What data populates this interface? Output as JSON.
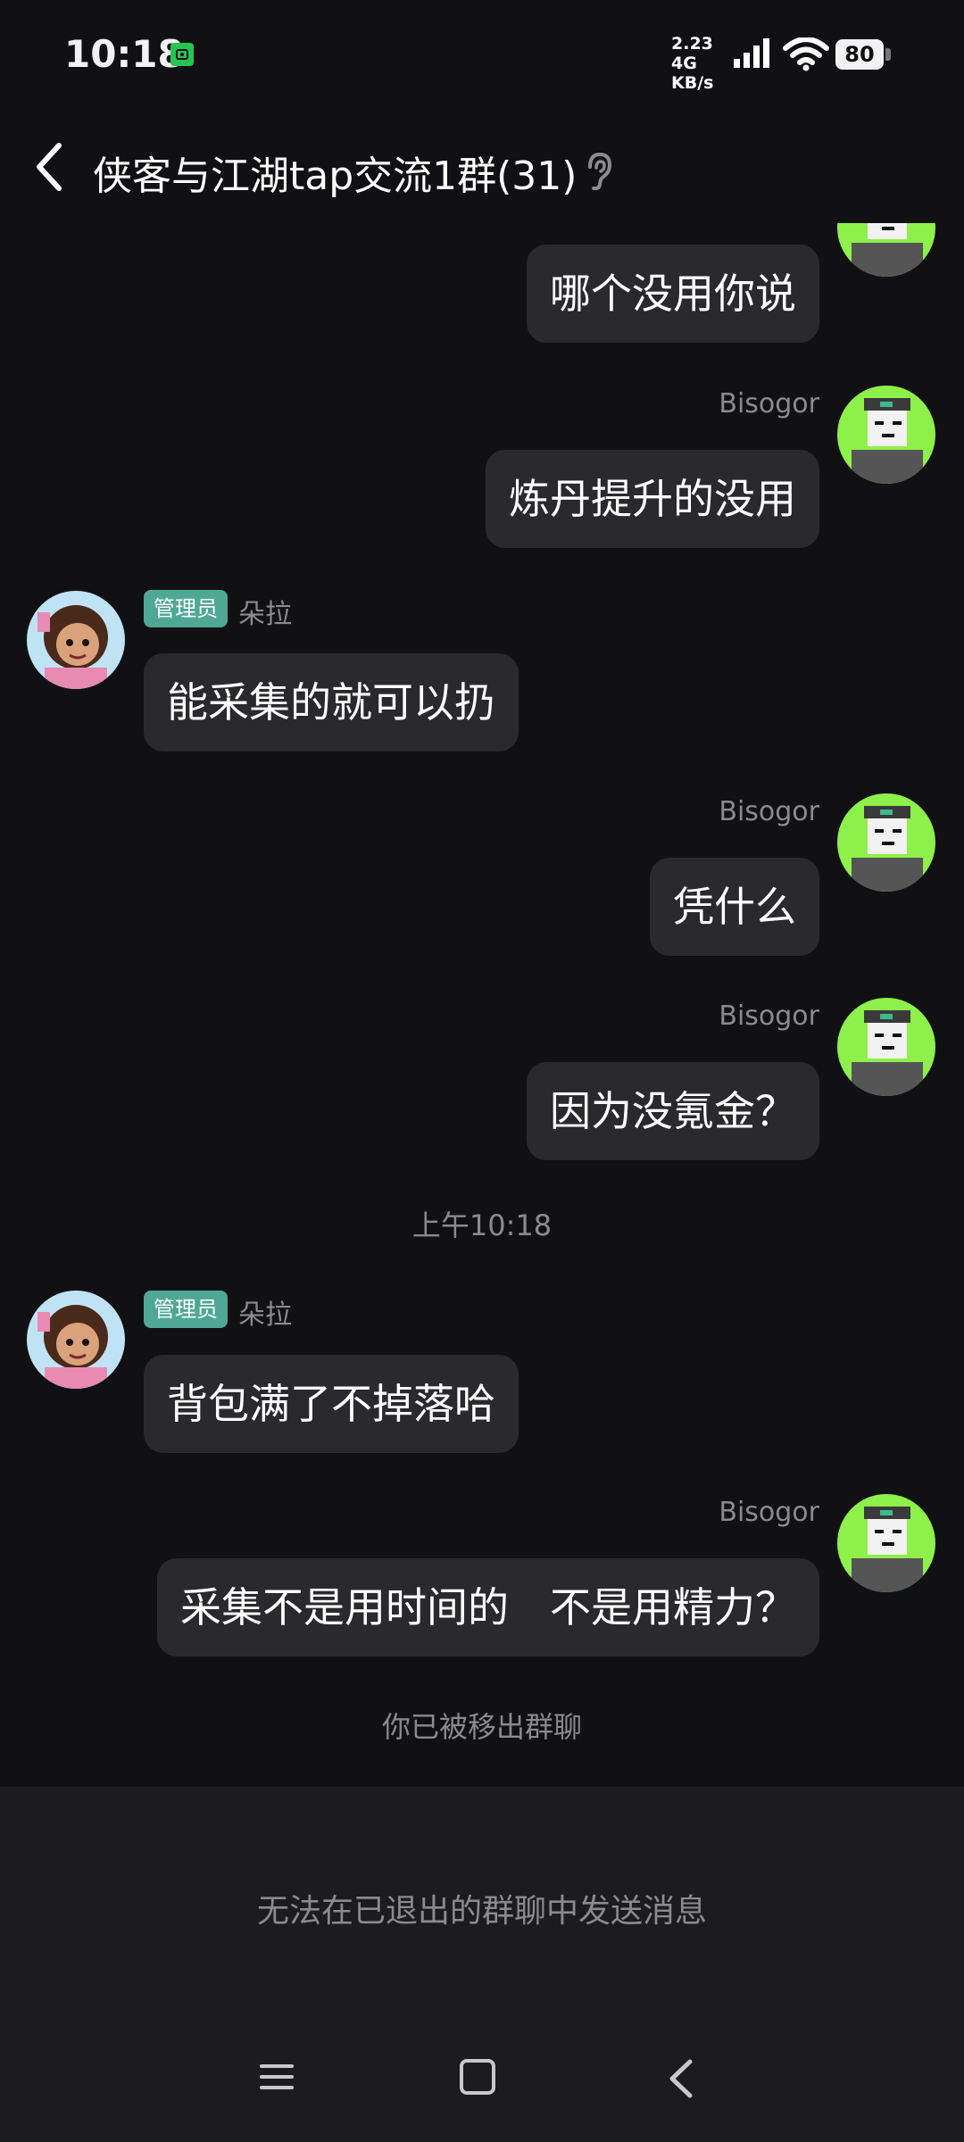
{
  "status_bar": {
    "time": "10:18",
    "net_speed_value": "2.23 4G",
    "net_speed_unit": "KB/s",
    "battery": "80",
    "icons": [
      "app-notification-icon",
      "signal-icon",
      "wifi-icon",
      "battery-icon"
    ]
  },
  "header": {
    "title": "侠客与江湖tap交流1群(31)",
    "icons": [
      "back-icon",
      "ear-icon"
    ]
  },
  "messages": [
    {
      "side": "right",
      "sender": "",
      "text": "哪个没用你说"
    },
    {
      "side": "right",
      "sender": "Bisogor",
      "text": "炼丹提升的没用"
    },
    {
      "side": "left",
      "badge": "管理员",
      "sender": "朵拉",
      "text": "能采集的就可以扔"
    },
    {
      "side": "right",
      "sender": "Bisogor",
      "text": "凭什么"
    },
    {
      "side": "right",
      "sender": "Bisogor",
      "text": "因为没氪金？"
    },
    {
      "timestamp": "上午10:18"
    },
    {
      "side": "left",
      "badge": "管理员",
      "sender": "朵拉",
      "text": "背包满了不掉落哈"
    },
    {
      "side": "right",
      "sender": "Bisogor",
      "text": "采集不是用时间的　不是用精力？"
    }
  ],
  "system_notice": "你已被移出群聊",
  "input_area": {
    "disabled_text": "无法在已退出的群聊中发送消息"
  },
  "nav_bar": {
    "icons": [
      "menu-icon",
      "home-icon",
      "back-nav-icon"
    ]
  },
  "colors": {
    "background": "#111113",
    "bubble": "#2a2a2d",
    "admin_badge": "#4fa896",
    "muted_text": "#8b8b8f",
    "avatar_green": "#8ef04a"
  }
}
